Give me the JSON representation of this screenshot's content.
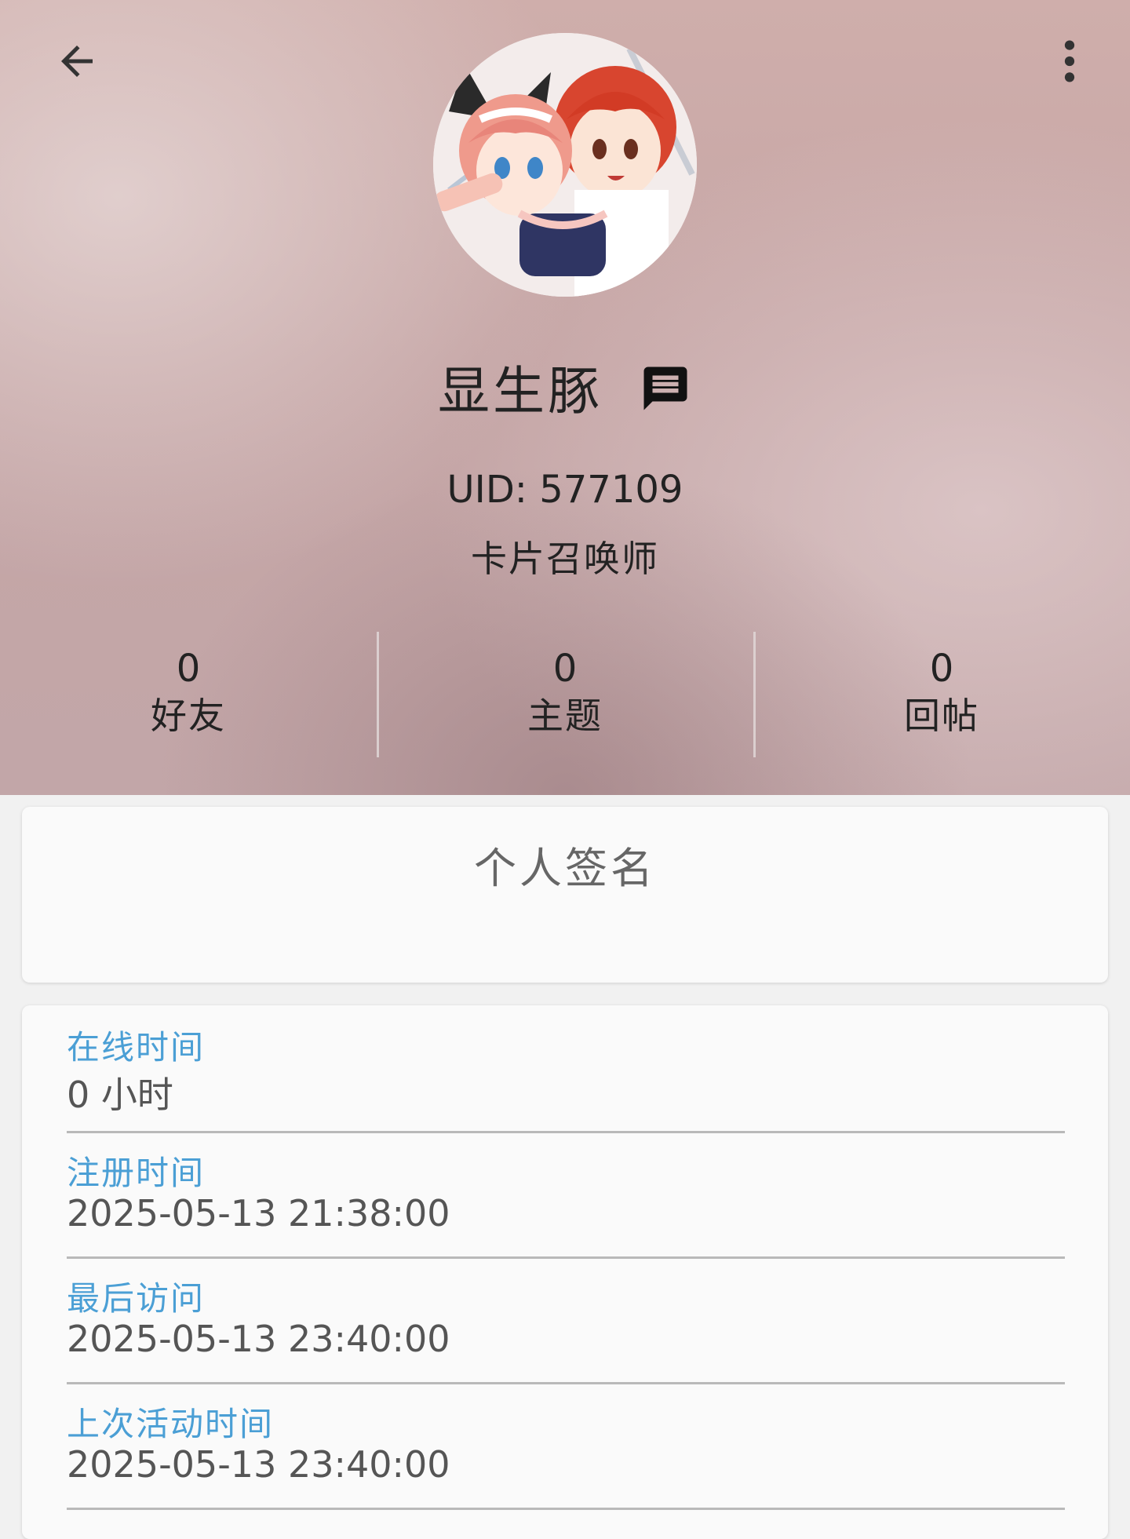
{
  "profile": {
    "username": "显生豚",
    "uid": "UID: 577109",
    "group": "卡片召唤师"
  },
  "icons": {
    "back": "arrow-back-icon",
    "more": "more-vert-icon",
    "message": "message-icon",
    "avatar": "anime-avatar-image"
  },
  "stats": [
    {
      "value": "0",
      "label": "好友"
    },
    {
      "value": "0",
      "label": "主题"
    },
    {
      "value": "0",
      "label": "回帖"
    }
  ],
  "signature": {
    "title": "个人签名"
  },
  "info": [
    {
      "label": "在线时间",
      "value": "0 小时"
    },
    {
      "label": "注册时间",
      "value": "2025-05-13 21:38:00"
    },
    {
      "label": "最后访问",
      "value": "2025-05-13 23:40:00"
    },
    {
      "label": "上次活动时间",
      "value": "2025-05-13 23:40:00"
    }
  ],
  "colors": {
    "accent_label": "#4b9fd5",
    "header_bg": "#c5a5a5",
    "text_dark": "#222222"
  }
}
